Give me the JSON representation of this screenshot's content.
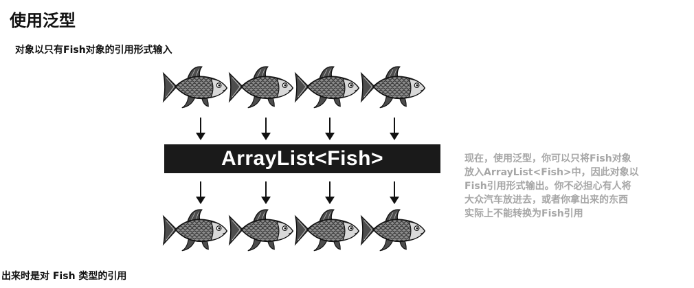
{
  "title": "使用泛型",
  "subtitle": "对象以只有Fish对象的引用形式输入",
  "container_label": "ArrayList<Fish>",
  "side_note": {
    "lines": [
      "现在，使用泛型，你可以只将Fish对象",
      "放入ArrayList<Fish>中，因此对象以",
      "Fish引用形式输出。你不必担心有人将",
      "大众汽车放进去，或者你拿出来的东西",
      "实际上不能转换为Fish引用"
    ]
  },
  "footer": "出来时是对 Fish 类型的引用",
  "icons": {
    "fish": "fish-icon",
    "arrow": "arrow-down-icon"
  },
  "colors": {
    "bar": "#1a1a1a",
    "bar_text": "#ffffff",
    "note_text": "#a6a6a6"
  }
}
